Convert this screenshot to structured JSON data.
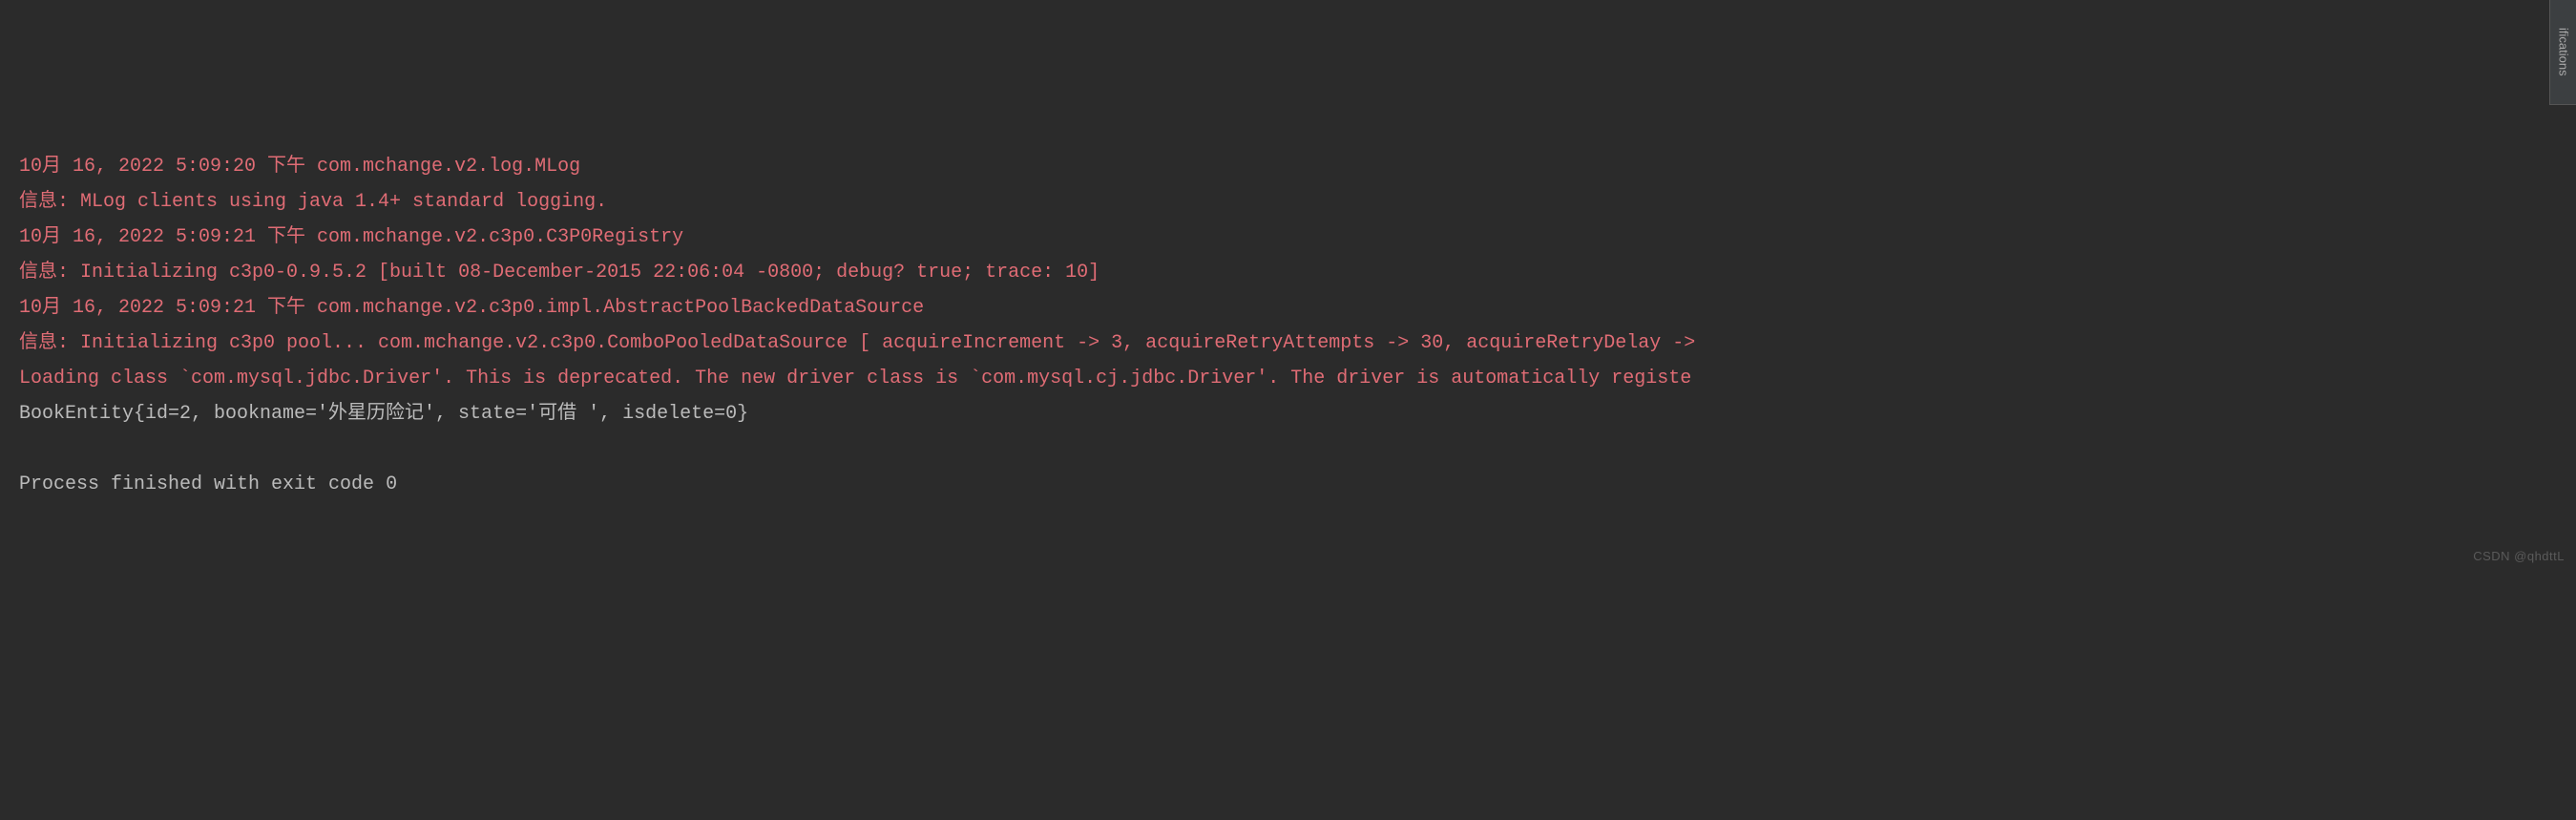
{
  "console": {
    "lines": [
      {
        "color": "red",
        "text": "10月 16, 2022 5:09:20 下午 com.mchange.v2.log.MLog"
      },
      {
        "color": "red",
        "text": "信息: MLog clients using java 1.4+ standard logging."
      },
      {
        "color": "red",
        "text": "10月 16, 2022 5:09:21 下午 com.mchange.v2.c3p0.C3P0Registry"
      },
      {
        "color": "red",
        "text": "信息: Initializing c3p0-0.9.5.2 [built 08-December-2015 22:06:04 -0800; debug? true; trace: 10]"
      },
      {
        "color": "red",
        "text": "10月 16, 2022 5:09:21 下午 com.mchange.v2.c3p0.impl.AbstractPoolBackedDataSource"
      },
      {
        "color": "red",
        "text": "信息: Initializing c3p0 pool... com.mchange.v2.c3p0.ComboPooledDataSource [ acquireIncrement -> 3, acquireRetryAttempts -> 30, acquireRetryDelay ->"
      },
      {
        "color": "red",
        "text": "Loading class `com.mysql.jdbc.Driver'. This is deprecated. The new driver class is `com.mysql.cj.jdbc.Driver'. The driver is automatically registe"
      },
      {
        "color": "white",
        "text": "BookEntity{id=2, bookname='外星历险记', state='可借 ', isdelete=0}"
      },
      {
        "color": "white",
        "text": ""
      },
      {
        "color": "white",
        "text": "Process finished with exit code 0"
      }
    ]
  },
  "sidebar": {
    "tab_label": "ifications"
  },
  "watermark": {
    "text": "CSDN @qhdttL"
  }
}
